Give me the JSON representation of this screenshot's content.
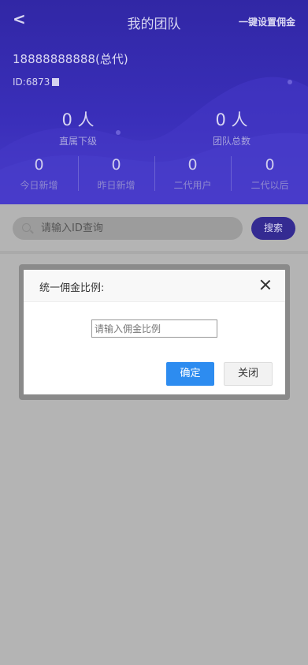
{
  "header": {
    "back_label": "<",
    "title": "我的团队",
    "set_commission_label": "一键设置佣金"
  },
  "user": {
    "name": "18888888888(总代)",
    "id": "ID:6873"
  },
  "summary": [
    {
      "value": "0 人",
      "label": "直属下级"
    },
    {
      "value": "0 人",
      "label": "团队总数"
    }
  ],
  "stats": [
    {
      "value": "0",
      "label": "今日新增"
    },
    {
      "value": "0",
      "label": "昨日新增"
    },
    {
      "value": "0",
      "label": "二代用户"
    },
    {
      "value": "0",
      "label": "二代以后"
    }
  ],
  "search": {
    "placeholder": "请输入ID查询",
    "button_label": "搜索"
  },
  "modal": {
    "title": "统一佣金比例:",
    "input_placeholder": "请输入佣金比例",
    "confirm_label": "确定",
    "close_label": "关闭"
  },
  "colors": {
    "header_bg": "#3a2fba",
    "overlay": "#b4b4b4",
    "confirm": "#2d8cf0",
    "search_button": "#342b92"
  }
}
